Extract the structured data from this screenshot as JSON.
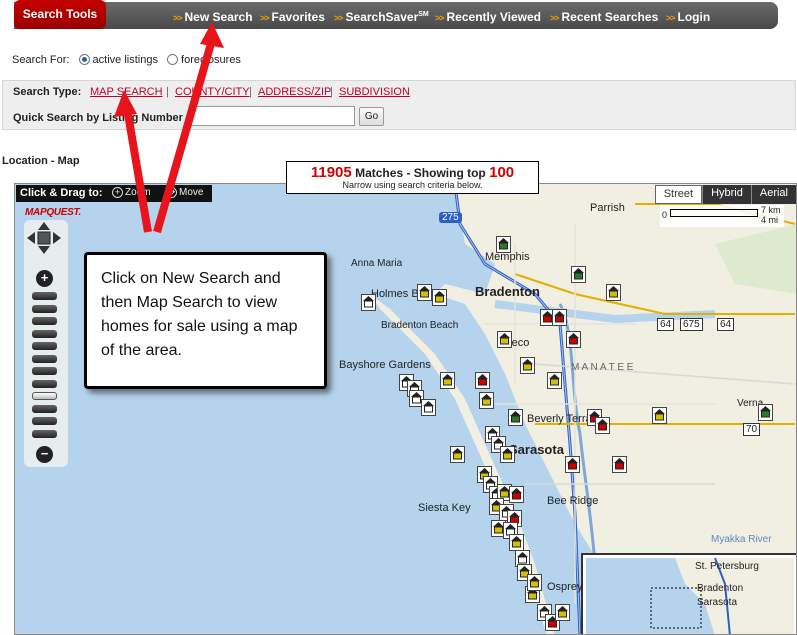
{
  "nav": {
    "tools_tab": "Search Tools",
    "arrows": ">>",
    "items": [
      {
        "label": "New Search"
      },
      {
        "label": "Favorites"
      },
      {
        "label": "SearchSaver",
        "sup": "SM"
      },
      {
        "label": "Recently Viewed"
      },
      {
        "label": "Recent Searches"
      },
      {
        "label": "Login"
      }
    ]
  },
  "search_for": {
    "label": "Search For:",
    "options": [
      {
        "label": "active listings",
        "selected": true
      },
      {
        "label": "foreclosures",
        "selected": false
      }
    ]
  },
  "search_type": {
    "label": "Search Type:",
    "links": [
      "MAP SEARCH",
      "COUNTY/CITY",
      "ADDRESS/ZIP",
      "SUBDIVISION"
    ],
    "separator": "|"
  },
  "quick_search": {
    "label": "Quick Search by Listing Number",
    "value": "",
    "go_label": "Go"
  },
  "location_label": "Location - Map",
  "matches": {
    "count": "11905",
    "middle": "Matches - Showing top",
    "top": "100",
    "hint": "Narrow using search criteria below."
  },
  "map": {
    "drag_label": "Click & Drag to:",
    "zoom_tool": "Zoom",
    "move_tool": "Move",
    "view_tabs": [
      {
        "label": "Street",
        "active": true
      },
      {
        "label": "Hybrid",
        "active": false
      },
      {
        "label": "Aerial",
        "active": false
      }
    ],
    "scale_km": "7 km",
    "scale_mi": "4 mi",
    "scale_zero": "0",
    "logo": "MAPQUEST.",
    "places": {
      "parrish": "Parrish",
      "memphis": "Memphis",
      "anna_maria": "Anna Maria",
      "holmes_beach": "Holmes Beach",
      "bradenton": "Bradenton",
      "bradenton_beach": "Bradenton Beach",
      "oneco": "Oneco",
      "manatee": "M A N A T E E",
      "bayshore": "Bayshore Gardens",
      "beverly_terrace": "Beverly Terrace",
      "sarasota": "Sarasota",
      "verna": "Verna",
      "bee_ridge": "Bee Ridge",
      "siesta_key": "Siesta Key",
      "osprey": "Osprey",
      "myakka": "Myakka River",
      "st_petersburg": "St. Petersburg",
      "inset_bradenton": "Bradenton",
      "inset_sarasota": "Sarasota"
    },
    "shields": [
      "275",
      "64",
      "675",
      "64",
      "70"
    ],
    "zoom_levels": 12,
    "active_zoom_level": 8
  },
  "callout": {
    "text": "Click on New Search and then Map Search to view homes for sale using a map of the area."
  },
  "colors": {
    "accent": "#c40000",
    "nav_bg": "#555555",
    "link": "#c0002a",
    "arrow": "#e8141c"
  }
}
